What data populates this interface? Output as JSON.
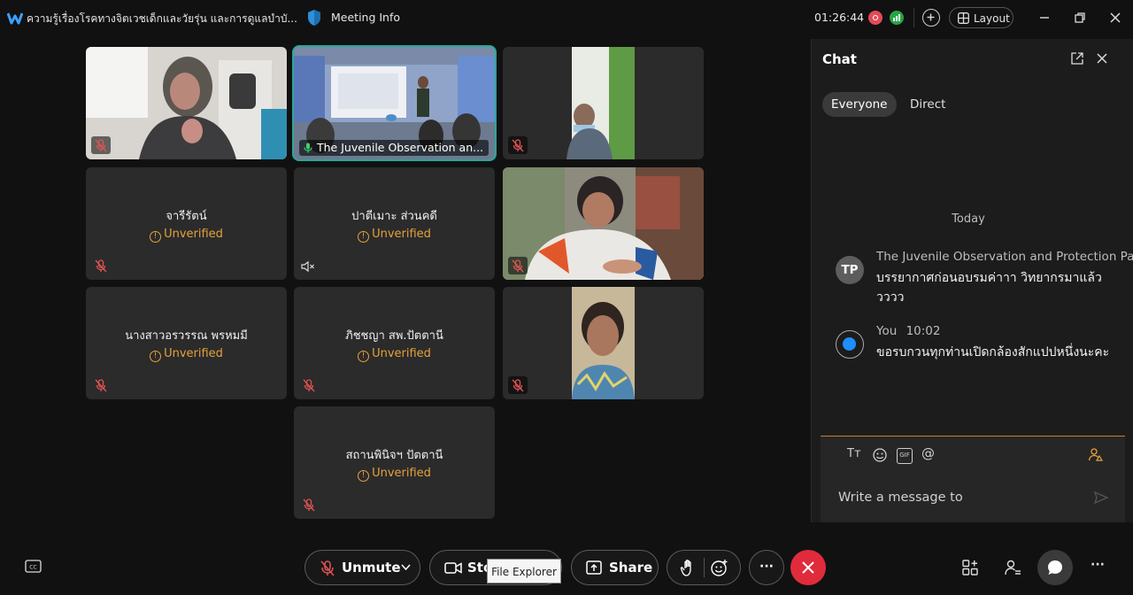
{
  "titlebar": {
    "meeting_title": "ความรู้เรื่องโรคทางจิตเวชเด็กและวัยรุ่น และการดูแลบำบั...",
    "meeting_info": "Meeting Info",
    "timer": "01:26:44",
    "layout_label": "Layout"
  },
  "participants": [
    {
      "type": "video",
      "name": ""
    },
    {
      "type": "video",
      "name": "The Juvenile Observation  an...",
      "active": true
    },
    {
      "type": "video",
      "name": ""
    },
    {
      "type": "placeholder",
      "name": "จารีรัตน์",
      "status": "Unverified"
    },
    {
      "type": "placeholder",
      "name": "ปาตีเมาะ ส่วนคดี",
      "status": "Unverified"
    },
    {
      "type": "video",
      "name": ""
    },
    {
      "type": "placeholder",
      "name": "นางสาวอรวรรณ พรหมมี",
      "status": "Unverified"
    },
    {
      "type": "placeholder",
      "name": "ภิชชญา สพ.ปัตตานี",
      "status": "Unverified"
    },
    {
      "type": "video",
      "name": ""
    },
    {
      "type": "placeholder",
      "name": "สถานพินิจฯ ปัตตานี",
      "status": "Unverified"
    }
  ],
  "chat": {
    "title": "Chat",
    "tabs": [
      "Everyone",
      "Direct"
    ],
    "day_separator": "Today",
    "messages": [
      {
        "avatar": "TP",
        "sender": "The Juvenile Observation and Protection Patt",
        "time": "",
        "text": "บรรยากาศก่อนอบรมค่าาา วิทยากรมาแล้ววววว"
      },
      {
        "avatar": "",
        "sender": "You",
        "time": "10:02",
        "text": "ขอรบกวนทุกท่านเปิดกล้องสักแปปหนึ่งนะคะ"
      }
    ],
    "composer_placeholder": "Write a message to",
    "tool_text": "Tт",
    "tool_gif": "GIF",
    "tool_at": "@"
  },
  "controls": {
    "unmute_label": "Unmute",
    "video_label": "Stop video",
    "share_label": "Share",
    "more_label": "···",
    "right_more_label": "···"
  },
  "tooltip": "File Explorer",
  "colors": {
    "accent_active": "#2aa897",
    "unverified": "#e6a23c",
    "end_call": "#e02b3d"
  }
}
